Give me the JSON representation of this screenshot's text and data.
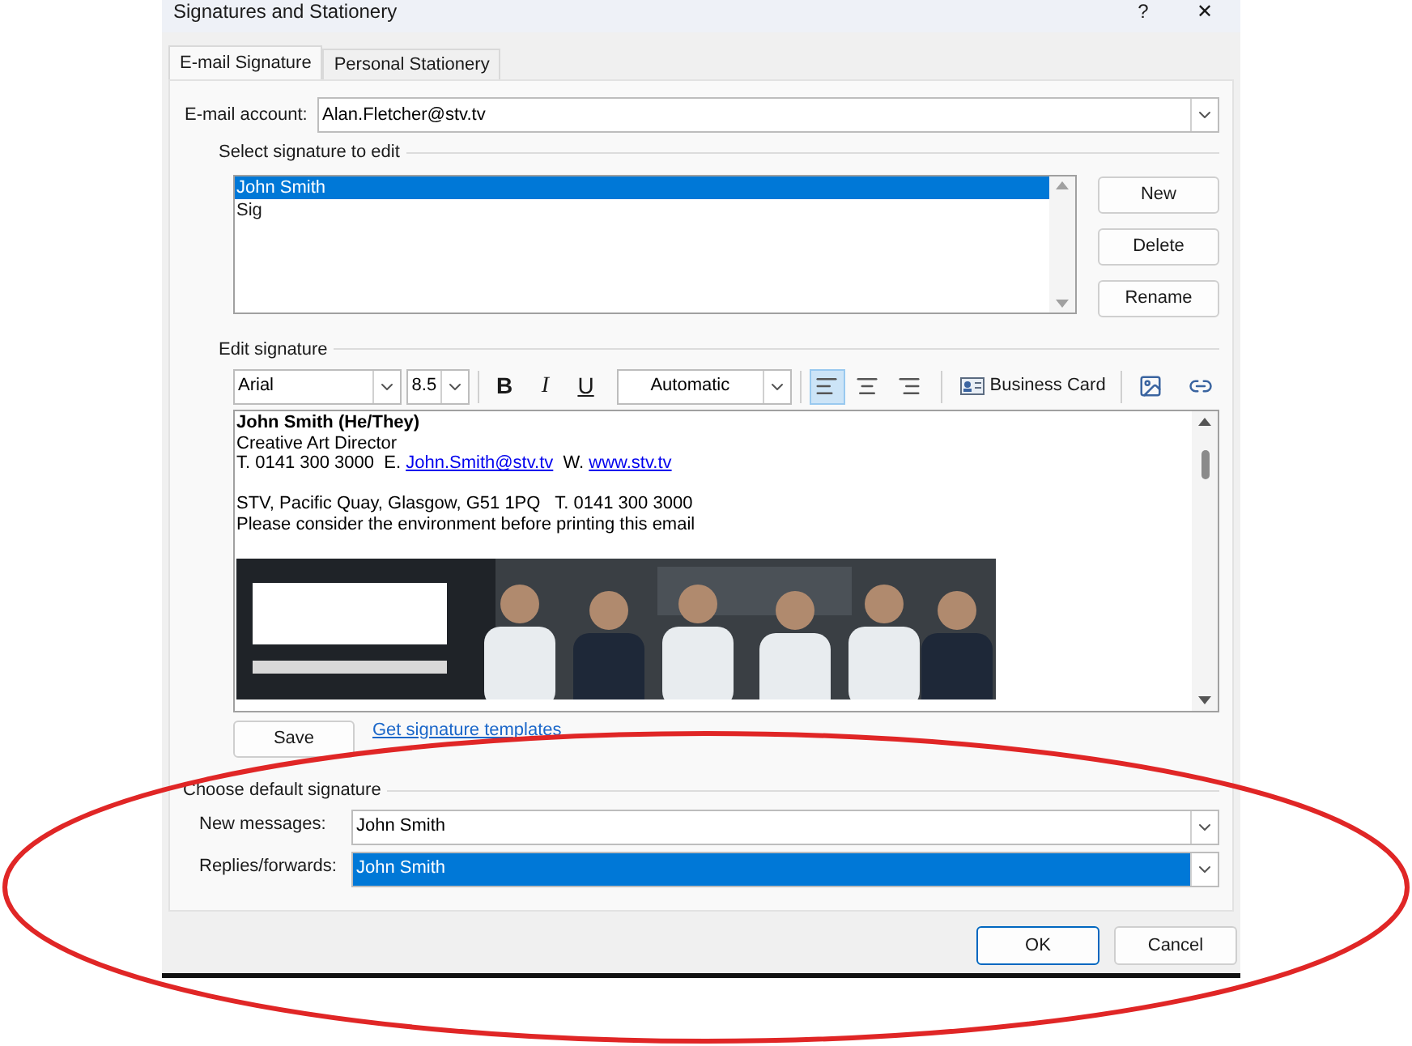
{
  "window": {
    "title": "Signatures and Stationery",
    "help": "?",
    "close": "✕"
  },
  "tabs": [
    {
      "label": "E-mail Signature",
      "selected": true
    },
    {
      "label": "Personal Stationery",
      "selected": false
    }
  ],
  "account": {
    "label": "E-mail account:",
    "value": "Alan.Fletcher@stv.tv"
  },
  "select_signature": {
    "heading": "Select signature to edit",
    "items": [
      {
        "label": "John Smith",
        "selected": true
      },
      {
        "label": "Sig",
        "selected": false
      }
    ],
    "buttons": [
      "New",
      "Delete",
      "Rename"
    ]
  },
  "edit_signature": {
    "heading": "Edit signature",
    "font": "Arial",
    "size": "8.5",
    "format_buttons": [
      {
        "label": "B",
        "kind": "bold"
      },
      {
        "label": "I",
        "kind": "italic"
      },
      {
        "label": "U",
        "kind": "underline"
      }
    ],
    "color_name": "Automatic",
    "align_buttons": [
      {
        "kind": "left",
        "selected": true
      },
      {
        "kind": "center",
        "selected": false
      },
      {
        "kind": "right",
        "selected": false
      }
    ],
    "business_card": "Business Card",
    "lines": [
      {
        "kind": "text",
        "bold": true,
        "segments": [
          {
            "kind": "text",
            "text": "John Smith (He/They)"
          }
        ]
      },
      {
        "kind": "text",
        "bold": false,
        "segments": [
          {
            "kind": "text",
            "text": "Creative Art Director"
          }
        ]
      },
      {
        "kind": "text",
        "bold": false,
        "segments": [
          {
            "kind": "text",
            "text": "T. 0141 300 3000  E. "
          },
          {
            "kind": "link",
            "text": "John.Smith@stv.tv"
          },
          {
            "kind": "text",
            "text": "  W. "
          },
          {
            "kind": "link",
            "text": "www.stv.tv"
          }
        ]
      },
      {
        "kind": "blank"
      },
      {
        "kind": "text",
        "bold": false,
        "segments": [
          {
            "kind": "text",
            "text": "STV, Pacific Quay, Glasgow, G51 1PQ   T. 0141 300 3000"
          }
        ]
      },
      {
        "kind": "text",
        "bold": false,
        "segments": [
          {
            "kind": "text",
            "text": "Please consider the environment before printing this email"
          }
        ]
      },
      {
        "kind": "blank"
      },
      {
        "kind": "picture"
      }
    ],
    "save": "Save",
    "templates_link": "Get signature templates"
  },
  "default_signature": {
    "heading": "Choose default signature",
    "fields": [
      {
        "label": "New messages:",
        "value": "John Smith",
        "selected": false
      },
      {
        "label": "Replies/forwards:",
        "value": "John Smith",
        "selected": true
      }
    ]
  },
  "footer_buttons": [
    {
      "label": "OK",
      "kind": "primary"
    },
    {
      "label": "Cancel",
      "kind": "secondary"
    }
  ],
  "annotation": {
    "kind": "ellipse",
    "color": "#e02626"
  }
}
